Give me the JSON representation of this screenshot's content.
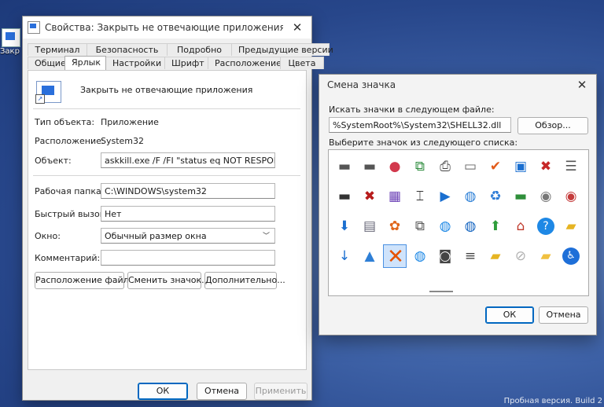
{
  "desktop": {
    "icon_label": "Закр отвеч"
  },
  "watermark": "Пробная версия. Build 2",
  "props": {
    "title": "Свойства: Закрыть не отвечающие приложения",
    "tabs_top": [
      "Терминал",
      "Безопасность",
      "Подробно",
      "Предыдущие версии"
    ],
    "tabs_bottom": [
      "Общие",
      "Ярлык",
      "Настройки",
      "Шрифт",
      "Расположение",
      "Цвета"
    ],
    "active_tab": "Ярлык",
    "app_name": "Закрыть не отвечающие приложения",
    "type_label": "Тип объекта:",
    "type_value": "Приложение",
    "location_label": "Расположение:",
    "location_value": "System32",
    "target_label": "Объект:",
    "target_value": "askkill.exe /F /FI \"status eq NOT RESPONDING\"",
    "workdir_label": "Рабочая папка:",
    "workdir_value": "C:\\WINDOWS\\system32",
    "hotkey_label": "Быстрый вызов:",
    "hotkey_value": "Нет",
    "window_label": "Окно:",
    "window_value": "Обычный размер окна",
    "comment_label": "Комментарий:",
    "comment_value": "",
    "btn_file_location": "Расположение файла",
    "btn_change_icon": "Сменить значок...",
    "btn_advanced": "Дополнительно...",
    "ok": "ОК",
    "cancel": "Отмена",
    "apply": "Применить"
  },
  "change_icon": {
    "title": "Смена значка",
    "search_label": "Искать значки в следующем файле:",
    "file_value": "%SystemRoot%\\System32\\SHELL32.dll",
    "browse": "Обзор...",
    "list_label": "Выберите значок из следующего списка:",
    "ok": "ОК",
    "cancel": "Отмена",
    "icons": [
      "drive-icon",
      "drive-icon",
      "media-disc-icon",
      "copy-arrow-icon",
      "printer-icon",
      "projector-icon",
      "checkmark-icon",
      "monitor-icon",
      "drive-error-icon",
      "list-window-icon",
      "drive-network-icon",
      "drive-disconnected-icon",
      "film-icon",
      "text-cursor-icon",
      "play-icon",
      "globe-window-icon",
      "recycle-icon",
      "drive-green-icon",
      "disc-icon",
      "disc-red-icon",
      "download-icon",
      "document-icon",
      "butterfly-icon",
      "copy-document-icon",
      "globe-network-icon",
      "globe-key-icon",
      "green-arrow-up-icon",
      "home-icon",
      "help-icon",
      "folder-sync-icon",
      "download-small-icon",
      "picture-icon",
      "delete-x-icon",
      "globe-arrow-icon",
      "camera-icon",
      "stack-icon",
      "folder-lock-icon",
      "blocked-icon",
      "folder-icon",
      "accessibility-icon"
    ]
  },
  "colors": {
    "accent": "#0067c0",
    "desktop": "#3f63a8"
  }
}
